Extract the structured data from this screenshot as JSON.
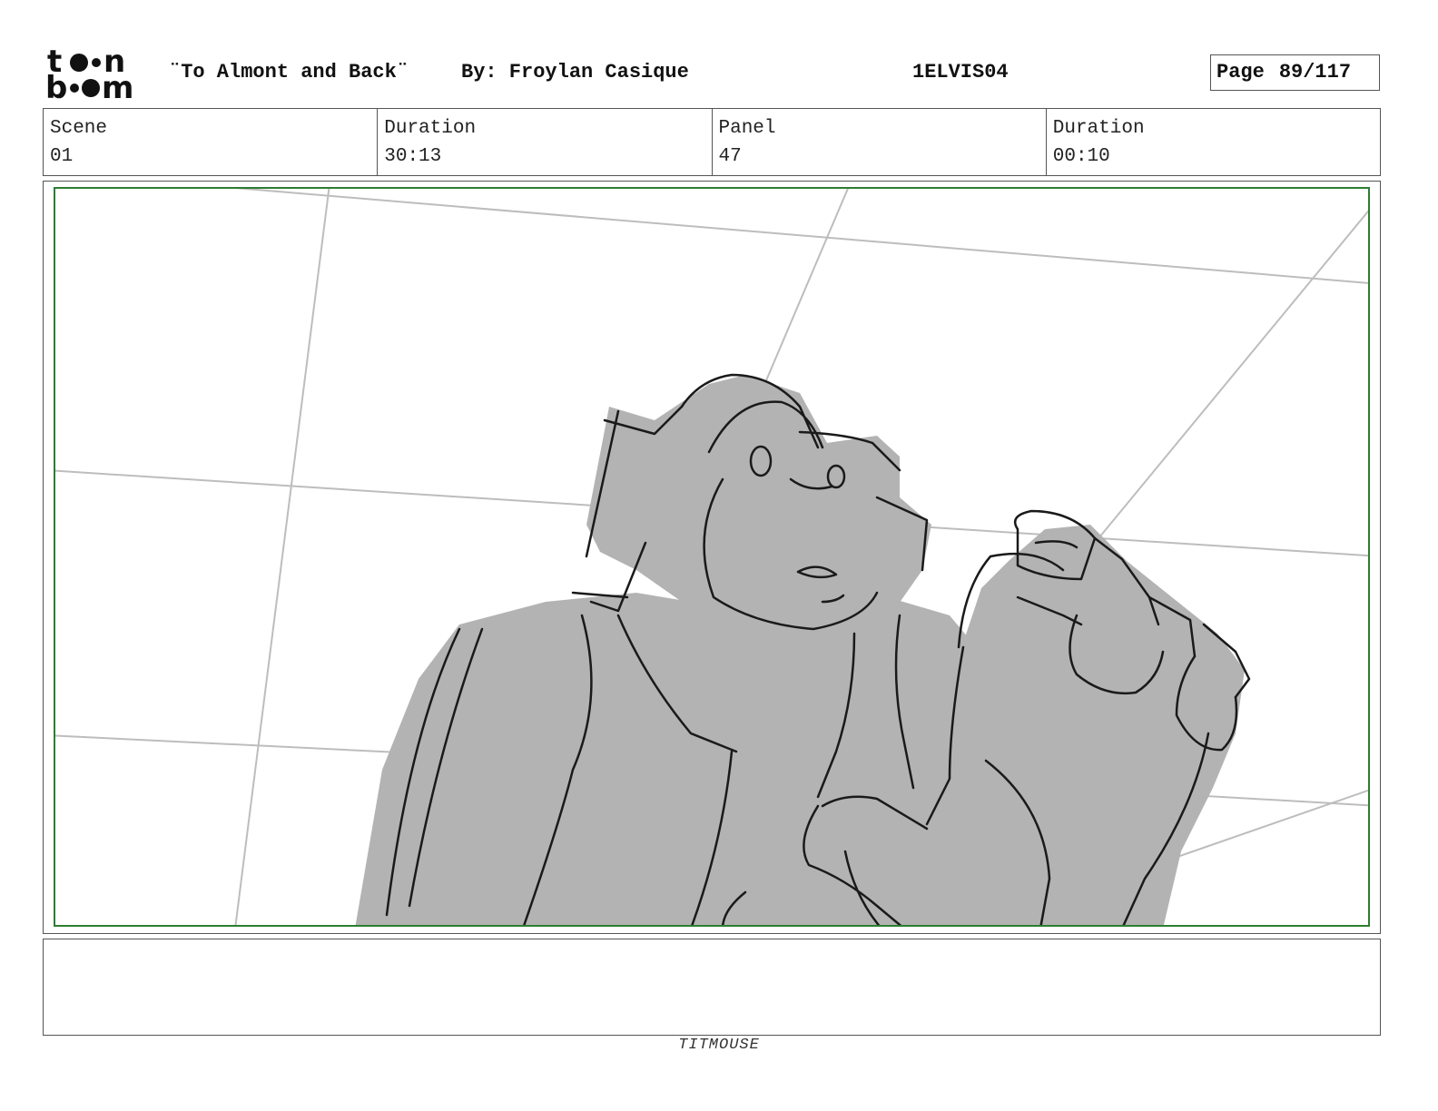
{
  "header": {
    "logo_text_top": "to•n",
    "logo_text_bottom": "b•om",
    "title": "¨To Almont and Back¨",
    "author": "By: Froylan Casique",
    "episode_code": "1ELVIS04",
    "page_label": "Page",
    "page_number": "89/117"
  },
  "info": {
    "scene_label": "Scene",
    "scene_value": "01",
    "scene_duration_label": "Duration",
    "scene_duration_value": "30:13",
    "panel_label": "Panel",
    "panel_value": "47",
    "panel_duration_label": "Duration",
    "panel_duration_value": "00:10"
  },
  "notes": {
    "text": ""
  },
  "footer": {
    "studio": "TITMOUSE"
  },
  "colors": {
    "safe_frame": "#2e7d32",
    "character_fill": "#b3b3b3",
    "perspective_lines": "#bdbdbd"
  }
}
